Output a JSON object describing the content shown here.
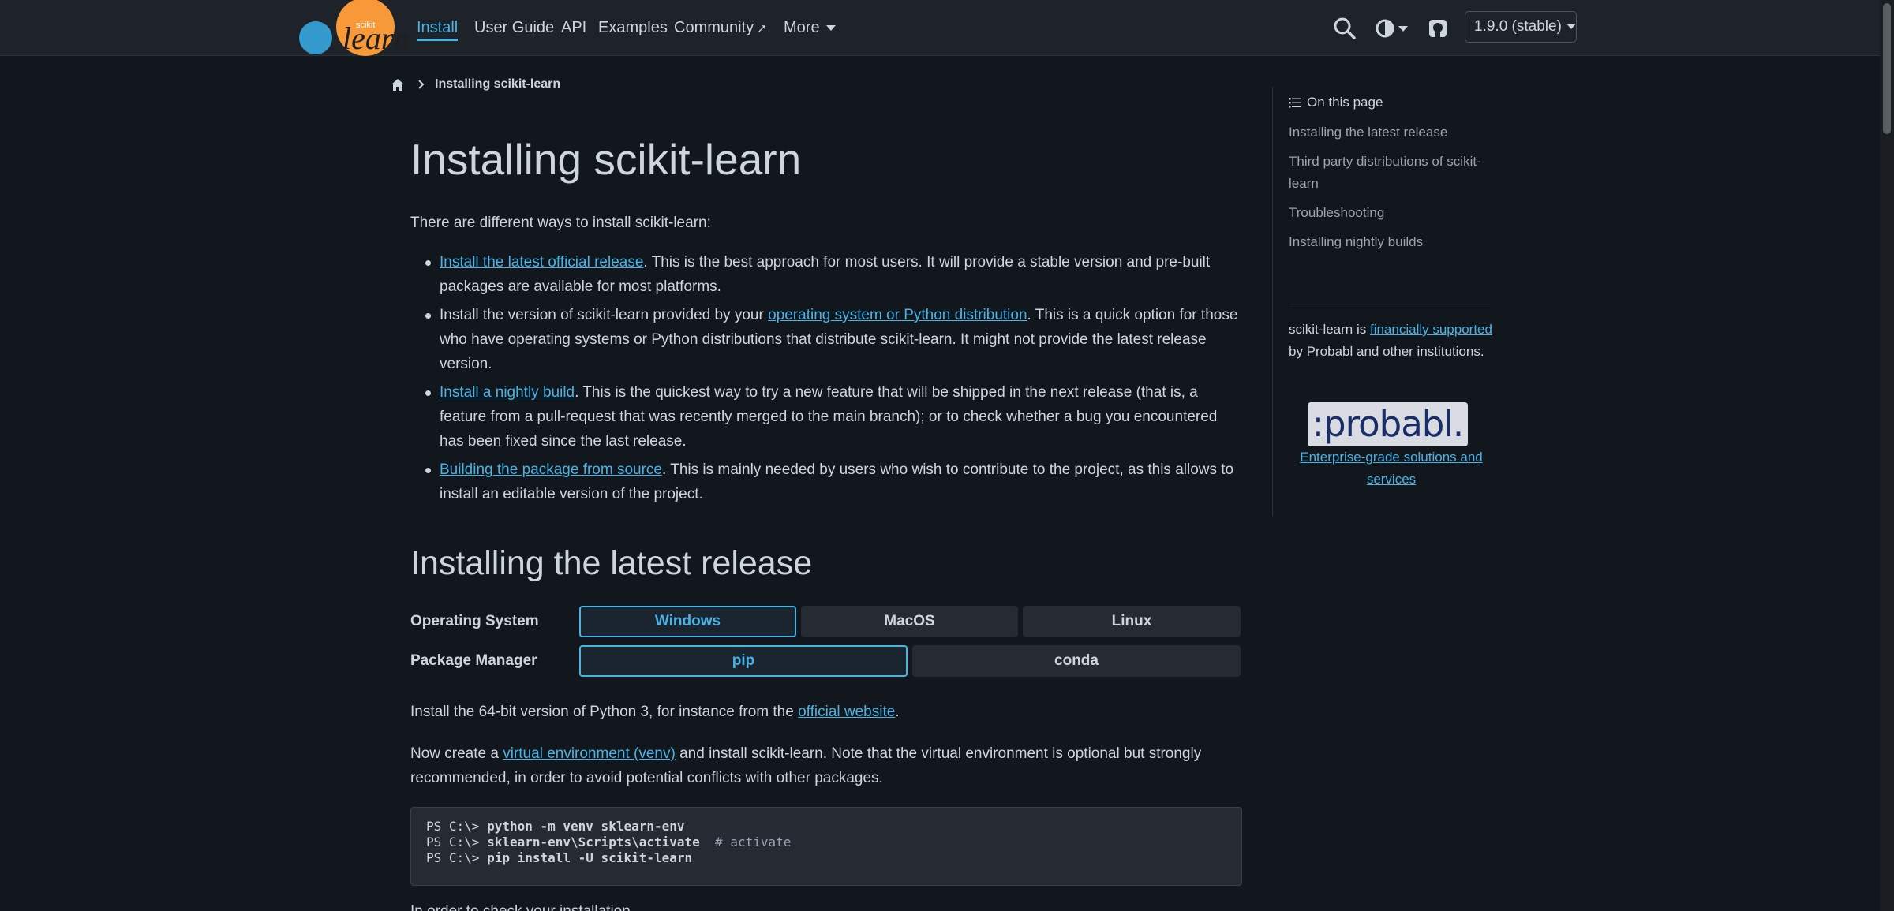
{
  "nav": {
    "links": [
      {
        "label": "Install"
      },
      {
        "label": "User Guide"
      },
      {
        "label": "API"
      },
      {
        "label": "Examples"
      },
      {
        "label": "Community"
      },
      {
        "label": "More"
      }
    ],
    "logo_text_small": "scikit",
    "logo_text": "learn",
    "version": "1.9.0 (stable)"
  },
  "breadcrumb": {
    "current": "Installing scikit-learn"
  },
  "main": {
    "title": "Installing scikit-learn",
    "intro": "There are different ways to install scikit-learn:",
    "ways": [
      {
        "link": "Install the latest official release",
        "before": "",
        "after": ". This is the best approach for most users. It will provide a stable version and pre-built packages are available for most platforms."
      },
      {
        "link": "operating system or Python distribution",
        "before": "Install the version of scikit-learn provided by your ",
        "after": ". This is a quick option for those who have operating systems or Python distributions that distribute scikit-learn. It might not provide the latest release version."
      },
      {
        "link": "Install a nightly build",
        "before": "",
        "after": ". This is the quickest way to try a new feature that will be shipped in the next release (that is, a feature from a pull-request that was recently merged to the main branch); or to check whether a bug you encountered has been fixed since the last release."
      },
      {
        "link": "Building the package from source",
        "before": "",
        "after": ". This is mainly needed by users who wish to contribute to the project, as this allows to install an editable version of the project."
      }
    ],
    "section_title": "Installing the latest release",
    "os_label": "Operating System",
    "os_options": [
      "Windows",
      "MacOS",
      "Linux"
    ],
    "pm_label": "Package Manager",
    "pm_options": [
      "pip",
      "conda"
    ],
    "python_para": {
      "before": "Install the 64-bit version of Python 3, for instance from the ",
      "link": "official website",
      "after": "."
    },
    "venv_para": {
      "before": "Now create a ",
      "link": "virtual environment (venv)",
      "after": " and install scikit-learn. Note that the virtual environment is optional but strongly recommended, in order to avoid potential conflicts with other packages."
    },
    "code": {
      "prompt": "PS C:\\> ",
      "line1": "python -m venv sklearn-env",
      "line2": "sklearn-env\\Scripts\\activate",
      "line2_comment": "# activate",
      "line3": "pip install -U scikit-learn"
    },
    "cut_text": "In order to check your installation"
  },
  "sidebar": {
    "toc_title": "On this page",
    "toc": [
      "Installing the latest release",
      "Third party distributions of scikit-learn",
      "Troubleshooting",
      "Installing nightly builds"
    ],
    "sponsor_before": "scikit-learn is ",
    "sponsor_link": "financially supported",
    "sponsor_after": " by Probabl and other institutions.",
    "probabl_logo": ":probabl.",
    "probabl_link": "Enterprise-grade solutions and services"
  }
}
